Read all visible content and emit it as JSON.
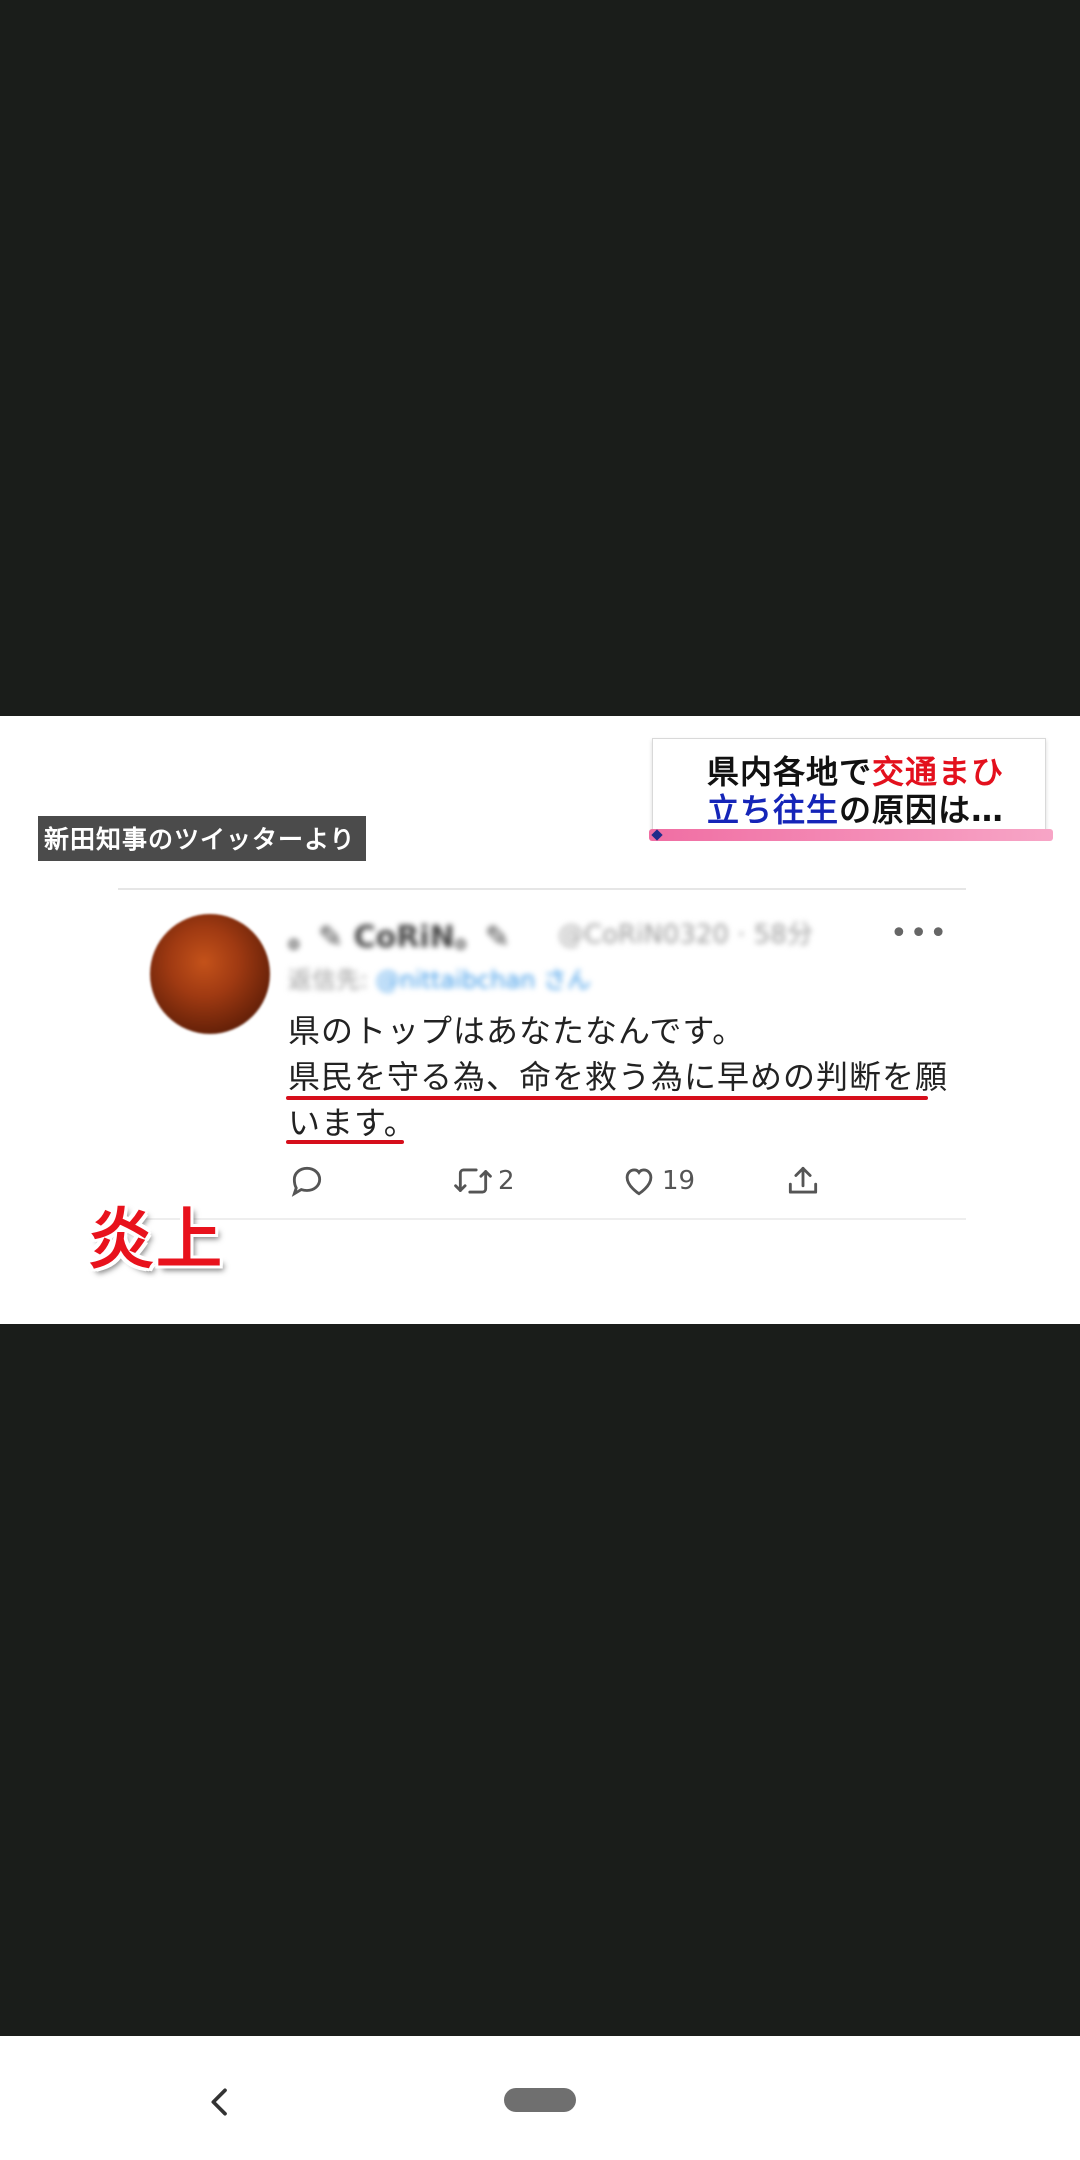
{
  "caption": {
    "source": "新田知事のツイッターより"
  },
  "headline": {
    "line1_part1": "県内各地で",
    "line1_part2": "交通まひ",
    "line2_part1": "立ち往生",
    "line2_part2": "の原因は…"
  },
  "tweet": {
    "display_name": "。✎ CoRiN。✎",
    "handle": "@CoRiN0320 · 58分",
    "reply_label": "返信先:",
    "reply_mention": "@nittaibchan さん",
    "more_label": "•••",
    "body_line1": "県のトップはあなたなんです。",
    "body_line2": "県民を守る為、命を救う為に早めの判断を願",
    "body_line3": "います。",
    "retweet_count": "2",
    "like_count": "19"
  },
  "stamp": {
    "text": "炎上"
  },
  "colors": {
    "accent_red": "#e3101d",
    "accent_blue": "#1525b8",
    "underline": "#d60e1b",
    "background": "#1a1d1a"
  },
  "icons": {
    "reply": "reply-icon",
    "retweet": "retweet-icon",
    "like": "heart-icon",
    "share": "share-icon",
    "back": "back-chevron-icon",
    "home": "home-pill-icon"
  }
}
